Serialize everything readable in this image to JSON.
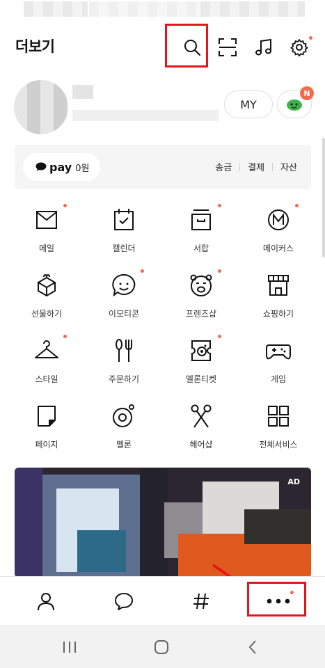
{
  "header": {
    "title": "더보기"
  },
  "profile": {
    "my_label": "MY",
    "badge_label": "N"
  },
  "pay": {
    "logo": "pay",
    "amount": "0원",
    "links": [
      "송금",
      "결제",
      "자산"
    ]
  },
  "grid": [
    {
      "label": "메일",
      "icon": "mail-icon",
      "new": true
    },
    {
      "label": "캘린더",
      "icon": "calendar-icon",
      "new": false
    },
    {
      "label": "서랍",
      "icon": "drawer-icon",
      "new": true
    },
    {
      "label": "메이커스",
      "icon": "makers-icon",
      "new": true
    },
    {
      "label": "선물하기",
      "icon": "gift-icon",
      "new": false
    },
    {
      "label": "이모티콘",
      "icon": "emoticon-icon",
      "new": true
    },
    {
      "label": "프렌즈샵",
      "icon": "friends-shop-icon",
      "new": true
    },
    {
      "label": "쇼핑하기",
      "icon": "shopping-icon",
      "new": false
    },
    {
      "label": "스타일",
      "icon": "hanger-icon",
      "new": true
    },
    {
      "label": "주문하기",
      "icon": "fork-knife-icon",
      "new": false
    },
    {
      "label": "멜론티켓",
      "icon": "melon-ticket-icon",
      "new": true
    },
    {
      "label": "게임",
      "icon": "gamepad-icon",
      "new": false
    },
    {
      "label": "페이지",
      "icon": "page-icon",
      "new": false
    },
    {
      "label": "멜론",
      "icon": "melon-icon",
      "new": false
    },
    {
      "label": "헤어샵",
      "icon": "scissors-icon",
      "new": false
    },
    {
      "label": "전체서비스",
      "icon": "all-services-icon",
      "new": false
    }
  ],
  "banner": {
    "ad_label": "AD"
  },
  "tabs": [
    {
      "name": "friends",
      "icon": "person-icon"
    },
    {
      "name": "chats",
      "icon": "chat-bubble-icon"
    },
    {
      "name": "view",
      "icon": "hashtag-icon"
    },
    {
      "name": "more",
      "icon": "more-dots-icon"
    }
  ],
  "colors": {
    "highlight": "#e8141c",
    "new_dot": "#f26b4e",
    "pay_bg": "#f5f5f5"
  }
}
